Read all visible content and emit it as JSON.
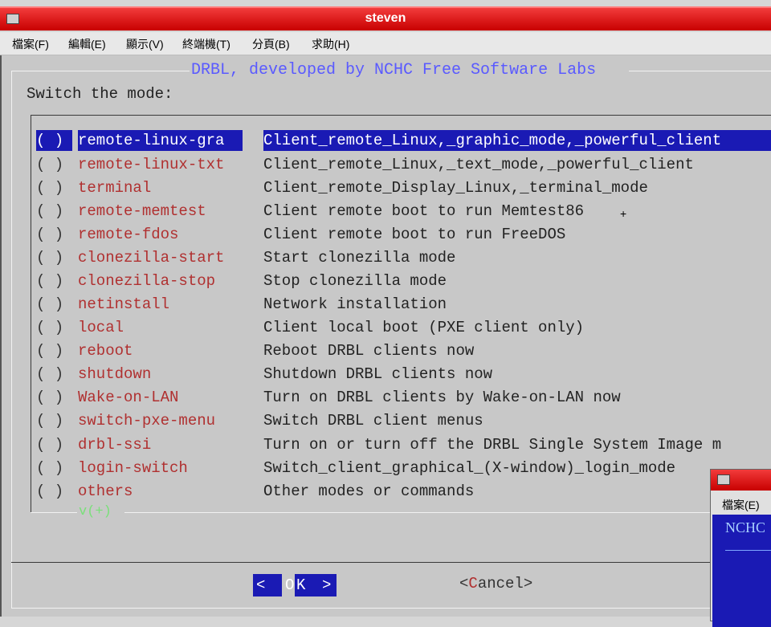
{
  "window": {
    "title": "steven"
  },
  "menu": [
    "檔案(F)",
    "編輯(E)",
    "顯示(V)",
    "終端機(T)",
    "分頁(B)",
    "求助(H)"
  ],
  "dialog": {
    "title": "DRBL, developed by NCHC Free Software Labs",
    "prompt": "Switch the mode:",
    "more_indicator": "v(+)",
    "items": [
      {
        "radio": "( )",
        "tag": "remote-linux-gra",
        "desc": "Client_remote_Linux,_graphic_mode,_powerful_client",
        "selected": true
      },
      {
        "radio": "( )",
        "tag": "remote-linux-txt",
        "desc": "Client_remote_Linux,_text_mode,_powerful_client"
      },
      {
        "radio": "( )",
        "tag": "terminal",
        "desc": "Client_remote_Display_Linux,_terminal_mode"
      },
      {
        "radio": "( )",
        "tag": "remote-memtest",
        "desc": "Client remote boot to run Memtest86"
      },
      {
        "radio": "( )",
        "tag": "remote-fdos",
        "desc": "Client remote boot to run FreeDOS"
      },
      {
        "radio": "( )",
        "tag": "clonezilla-start",
        "desc": "Start clonezilla mode"
      },
      {
        "radio": "( )",
        "tag": "clonezilla-stop",
        "desc": "Stop clonezilla mode"
      },
      {
        "radio": "( )",
        "tag": "netinstall",
        "desc": "Network installation"
      },
      {
        "radio": "( )",
        "tag": "local",
        "desc": "Client local boot (PXE client only)"
      },
      {
        "radio": "( )",
        "tag": "reboot",
        "desc": "Reboot DRBL clients now"
      },
      {
        "radio": "( )",
        "tag": "shutdown",
        "desc": "Shutdown DRBL clients now"
      },
      {
        "radio": "( )",
        "tag": "Wake-on-LAN",
        "desc": "Turn on DRBL clients by Wake-on-LAN now"
      },
      {
        "radio": "( )",
        "tag": "switch-pxe-menu",
        "desc": "Switch DRBL client menus"
      },
      {
        "radio": "( )",
        "tag": "drbl-ssi",
        "desc": "Turn on or turn off the DRBL Single System Image m"
      },
      {
        "radio": "( )",
        "tag": "login-switch",
        "desc": "Switch_client_graphical_(X-window)_login_mode"
      },
      {
        "radio": "( )",
        "tag": "others",
        "desc": "Other modes or commands"
      }
    ],
    "buttons": {
      "ok": {
        "left": "<",
        "hot": "O",
        "rest": "K",
        "right": ">"
      },
      "cancel": {
        "left": "<",
        "hot": "C",
        "rest": "ancel",
        "right": ">"
      }
    }
  },
  "second_window": {
    "menu": "檔案(E)",
    "text": "NCHC"
  },
  "colors": {
    "titlebar": "#d40000",
    "selection": "#1a1ab4",
    "tag_text": "#b03030",
    "dialog_title": "#5a5aff"
  }
}
